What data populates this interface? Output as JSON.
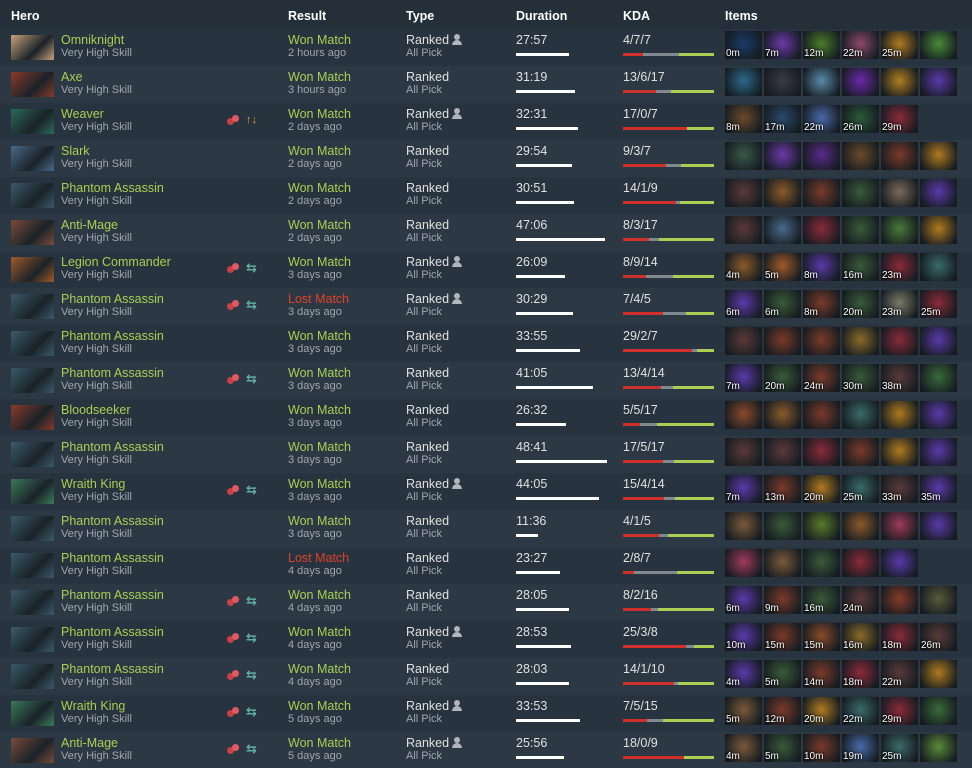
{
  "header": {
    "hero": "Hero",
    "result": "Result",
    "type": "Type",
    "duration": "Duration",
    "kda": "KDA",
    "items": "Items"
  },
  "colors": {
    "won": "#a9cf54",
    "lost": "#e0402a",
    "kills": "#d0302a",
    "deaths": "#808890",
    "assists": "#a9cf54"
  },
  "matches": [
    {
      "hero": "Omniknight",
      "hero_color": "#c9a37a",
      "skill": "Very High Skill",
      "party": false,
      "lane": "",
      "result": "Won Match",
      "won": true,
      "ago": "2 hours ago",
      "type": "Ranked",
      "solo": true,
      "mode": "All Pick",
      "duration": "27:57",
      "dur_frac": 0.58,
      "kda": "4/7/7",
      "k": 4,
      "d": 7,
      "a": 7,
      "items": [
        {
          "c": "#1a3a66",
          "t": "0m"
        },
        {
          "c": "#6a3aaa",
          "t": "7m"
        },
        {
          "c": "#4a7a2a",
          "t": "12m"
        },
        {
          "c": "#8a4a6a",
          "t": "22m"
        },
        {
          "c": "#b07a20",
          "t": "25m"
        },
        {
          "c": "#4a8a3a",
          "t": ""
        }
      ]
    },
    {
      "hero": "Axe",
      "hero_color": "#8a3a2a",
      "skill": "Very High Skill",
      "party": false,
      "lane": "",
      "result": "Won Match",
      "won": true,
      "ago": "3 hours ago",
      "type": "Ranked",
      "solo": false,
      "mode": "All Pick",
      "duration": "31:19",
      "dur_frac": 0.65,
      "kda": "13/6/17",
      "k": 13,
      "d": 6,
      "a": 17,
      "items": [
        {
          "c": "#2a6a8a",
          "t": ""
        },
        {
          "c": "#3a3a4a",
          "t": ""
        },
        {
          "c": "#5a8aaa",
          "t": ""
        },
        {
          "c": "#6a2aaa",
          "t": ""
        },
        {
          "c": "#b08020",
          "t": ""
        },
        {
          "c": "#5a3aaa",
          "t": ""
        }
      ]
    },
    {
      "hero": "Weaver",
      "hero_color": "#2a6a5a",
      "skill": "Very High Skill",
      "party": true,
      "lane": "swap",
      "result": "Won Match",
      "won": true,
      "ago": "2 days ago",
      "type": "Ranked",
      "solo": true,
      "mode": "All Pick",
      "duration": "32:31",
      "dur_frac": 0.68,
      "kda": "17/0/7",
      "k": 17,
      "d": 0,
      "a": 7,
      "items": [
        {
          "c": "#6a4a2a",
          "t": "8m"
        },
        {
          "c": "#2a4a6a",
          "t": "17m"
        },
        {
          "c": "#4a6aaa",
          "t": "22m"
        },
        {
          "c": "#2a5a3a",
          "t": "26m"
        },
        {
          "c": "#8a2a3a",
          "t": "29m"
        }
      ]
    },
    {
      "hero": "Slark",
      "hero_color": "#4a6a8a",
      "skill": "Very High Skill",
      "party": false,
      "lane": "",
      "result": "Won Match",
      "won": true,
      "ago": "2 days ago",
      "type": "Ranked",
      "solo": false,
      "mode": "All Pick",
      "duration": "29:54",
      "dur_frac": 0.62,
      "kda": "9/3/7",
      "k": 9,
      "d": 3,
      "a": 7,
      "items": [
        {
          "c": "#3a5a4a",
          "t": ""
        },
        {
          "c": "#6a3aaa",
          "t": ""
        },
        {
          "c": "#5a2a8a",
          "t": ""
        },
        {
          "c": "#6a4a2a",
          "t": ""
        },
        {
          "c": "#7a3a2a",
          "t": ""
        },
        {
          "c": "#b07a20",
          "t": ""
        }
      ]
    },
    {
      "hero": "Phantom Assassin",
      "hero_color": "#3a5a6a",
      "skill": "Very High Skill",
      "party": false,
      "lane": "",
      "result": "Won Match",
      "won": true,
      "ago": "2 days ago",
      "type": "Ranked",
      "solo": false,
      "mode": "All Pick",
      "duration": "30:51",
      "dur_frac": 0.64,
      "kda": "14/1/9",
      "k": 14,
      "d": 1,
      "a": 9,
      "items": [
        {
          "c": "#5a3a3a",
          "t": ""
        },
        {
          "c": "#8a5a2a",
          "t": ""
        },
        {
          "c": "#7a3a2a",
          "t": ""
        },
        {
          "c": "#3a5a3a",
          "t": ""
        },
        {
          "c": "#7a6a5a",
          "t": ""
        },
        {
          "c": "#5a3aaa",
          "t": ""
        }
      ]
    },
    {
      "hero": "Anti-Mage",
      "hero_color": "#7a4a3a",
      "skill": "Very High Skill",
      "party": false,
      "lane": "",
      "result": "Won Match",
      "won": true,
      "ago": "2 days ago",
      "type": "Ranked",
      "solo": false,
      "mode": "All Pick",
      "duration": "47:06",
      "dur_frac": 0.98,
      "kda": "8/3/17",
      "k": 8,
      "d": 3,
      "a": 17,
      "items": [
        {
          "c": "#5a3a3a",
          "t": ""
        },
        {
          "c": "#4a6a8a",
          "t": ""
        },
        {
          "c": "#8a2a3a",
          "t": ""
        },
        {
          "c": "#3a5a3a",
          "t": ""
        },
        {
          "c": "#4a7a3a",
          "t": ""
        },
        {
          "c": "#b07a20",
          "t": ""
        }
      ]
    },
    {
      "hero": "Legion Commander",
      "hero_color": "#a05a2a",
      "skill": "Very High Skill",
      "party": true,
      "lane": "cycle",
      "result": "Won Match",
      "won": true,
      "ago": "3 days ago",
      "type": "Ranked",
      "solo": true,
      "mode": "All Pick",
      "duration": "26:09",
      "dur_frac": 0.54,
      "kda": "8/9/14",
      "k": 8,
      "d": 9,
      "a": 14,
      "items": [
        {
          "c": "#8a5a2a",
          "t": "4m"
        },
        {
          "c": "#a05a2a",
          "t": "5m"
        },
        {
          "c": "#5a3aaa",
          "t": "8m"
        },
        {
          "c": "#3a5a3a",
          "t": "16m"
        },
        {
          "c": "#8a2a3a",
          "t": "23m"
        },
        {
          "c": "#3a6a6a",
          "t": ""
        }
      ]
    },
    {
      "hero": "Phantom Assassin",
      "hero_color": "#3a5a6a",
      "skill": "Very High Skill",
      "party": true,
      "lane": "cycle",
      "result": "Lost Match",
      "won": false,
      "ago": "3 days ago",
      "type": "Ranked",
      "solo": true,
      "mode": "All Pick",
      "duration": "30:29",
      "dur_frac": 0.63,
      "kda": "7/4/5",
      "k": 7,
      "d": 4,
      "a": 5,
      "items": [
        {
          "c": "#5a3aaa",
          "t": "6m"
        },
        {
          "c": "#3a5a3a",
          "t": "6m"
        },
        {
          "c": "#7a3a2a",
          "t": "8m"
        },
        {
          "c": "#3a5a3a",
          "t": "20m"
        },
        {
          "c": "#7a7a6a",
          "t": "23m"
        },
        {
          "c": "#8a2a3a",
          "t": "25m"
        }
      ]
    },
    {
      "hero": "Phantom Assassin",
      "hero_color": "#3a5a6a",
      "skill": "Very High Skill",
      "party": false,
      "lane": "",
      "result": "Won Match",
      "won": true,
      "ago": "3 days ago",
      "type": "Ranked",
      "solo": false,
      "mode": "All Pick",
      "duration": "33:55",
      "dur_frac": 0.7,
      "kda": "29/2/7",
      "k": 29,
      "d": 2,
      "a": 7,
      "items": [
        {
          "c": "#5a3a3a",
          "t": ""
        },
        {
          "c": "#7a3a2a",
          "t": ""
        },
        {
          "c": "#7a3a2a",
          "t": ""
        },
        {
          "c": "#8a6a2a",
          "t": ""
        },
        {
          "c": "#8a2a3a",
          "t": ""
        },
        {
          "c": "#5a3aaa",
          "t": ""
        }
      ]
    },
    {
      "hero": "Phantom Assassin",
      "hero_color": "#3a5a6a",
      "skill": "Very High Skill",
      "party": true,
      "lane": "cycle",
      "result": "Won Match",
      "won": true,
      "ago": "3 days ago",
      "type": "Ranked",
      "solo": false,
      "mode": "All Pick",
      "duration": "41:05",
      "dur_frac": 0.85,
      "kda": "13/4/14",
      "k": 13,
      "d": 4,
      "a": 14,
      "items": [
        {
          "c": "#5a3aaa",
          "t": "7m"
        },
        {
          "c": "#3a5a3a",
          "t": "20m"
        },
        {
          "c": "#7a3a2a",
          "t": "24m"
        },
        {
          "c": "#3a5a3a",
          "t": "30m"
        },
        {
          "c": "#5a3a3a",
          "t": "38m"
        },
        {
          "c": "#3a6a3a",
          "t": ""
        }
      ]
    },
    {
      "hero": "Bloodseeker",
      "hero_color": "#8a3a2a",
      "skill": "Very High Skill",
      "party": false,
      "lane": "",
      "result": "Won Match",
      "won": true,
      "ago": "3 days ago",
      "type": "Ranked",
      "solo": false,
      "mode": "All Pick",
      "duration": "26:32",
      "dur_frac": 0.55,
      "kda": "5/5/17",
      "k": 5,
      "d": 5,
      "a": 17,
      "items": [
        {
          "c": "#8a4a2a",
          "t": ""
        },
        {
          "c": "#8a5a2a",
          "t": ""
        },
        {
          "c": "#7a3a2a",
          "t": ""
        },
        {
          "c": "#3a6a6a",
          "t": ""
        },
        {
          "c": "#b07a20",
          "t": ""
        },
        {
          "c": "#5a3aaa",
          "t": ""
        }
      ]
    },
    {
      "hero": "Phantom Assassin",
      "hero_color": "#3a5a6a",
      "skill": "Very High Skill",
      "party": false,
      "lane": "",
      "result": "Won Match",
      "won": true,
      "ago": "3 days ago",
      "type": "Ranked",
      "solo": false,
      "mode": "All Pick",
      "duration": "48:41",
      "dur_frac": 1.0,
      "kda": "17/5/17",
      "k": 17,
      "d": 5,
      "a": 17,
      "items": [
        {
          "c": "#5a3a3a",
          "t": ""
        },
        {
          "c": "#5a3a3a",
          "t": ""
        },
        {
          "c": "#8a2a3a",
          "t": ""
        },
        {
          "c": "#7a3a2a",
          "t": ""
        },
        {
          "c": "#b07a20",
          "t": ""
        },
        {
          "c": "#5a3aaa",
          "t": ""
        }
      ]
    },
    {
      "hero": "Wraith King",
      "hero_color": "#3a7a5a",
      "skill": "Very High Skill",
      "party": true,
      "lane": "cycle",
      "result": "Won Match",
      "won": true,
      "ago": "3 days ago",
      "type": "Ranked",
      "solo": true,
      "mode": "All Pick",
      "duration": "44:05",
      "dur_frac": 0.91,
      "kda": "15/4/14",
      "k": 15,
      "d": 4,
      "a": 14,
      "items": [
        {
          "c": "#5a3aaa",
          "t": "7m"
        },
        {
          "c": "#7a3a2a",
          "t": "13m"
        },
        {
          "c": "#b07a20",
          "t": "20m"
        },
        {
          "c": "#3a6a6a",
          "t": "25m"
        },
        {
          "c": "#5a3a3a",
          "t": "33m"
        },
        {
          "c": "#5a3aaa",
          "t": "35m"
        }
      ]
    },
    {
      "hero": "Phantom Assassin",
      "hero_color": "#3a5a6a",
      "skill": "Very High Skill",
      "party": false,
      "lane": "",
      "result": "Won Match",
      "won": true,
      "ago": "3 days ago",
      "type": "Ranked",
      "solo": false,
      "mode": "All Pick",
      "duration": "11:36",
      "dur_frac": 0.24,
      "kda": "4/1/5",
      "k": 4,
      "d": 1,
      "a": 5,
      "items": [
        {
          "c": "#7a5a3a",
          "t": ""
        },
        {
          "c": "#3a5a3a",
          "t": ""
        },
        {
          "c": "#5a7a2a",
          "t": ""
        },
        {
          "c": "#8a5a2a",
          "t": ""
        },
        {
          "c": "#a03a5a",
          "t": ""
        },
        {
          "c": "#5a3aaa",
          "t": ""
        }
      ]
    },
    {
      "hero": "Phantom Assassin",
      "hero_color": "#3a5a6a",
      "skill": "Very High Skill",
      "party": false,
      "lane": "",
      "result": "Lost Match",
      "won": false,
      "ago": "4 days ago",
      "type": "Ranked",
      "solo": false,
      "mode": "All Pick",
      "duration": "23:27",
      "dur_frac": 0.48,
      "kda": "2/8/7",
      "k": 2,
      "d": 8,
      "a": 7,
      "items": [
        {
          "c": "#a03a5a",
          "t": ""
        },
        {
          "c": "#7a5a3a",
          "t": ""
        },
        {
          "c": "#3a5a3a",
          "t": ""
        },
        {
          "c": "#8a2a3a",
          "t": ""
        },
        {
          "c": "#5a3aaa",
          "t": ""
        }
      ]
    },
    {
      "hero": "Phantom Assassin",
      "hero_color": "#3a5a6a",
      "skill": "Very High Skill",
      "party": true,
      "lane": "cycle",
      "result": "Won Match",
      "won": true,
      "ago": "4 days ago",
      "type": "Ranked",
      "solo": false,
      "mode": "All Pick",
      "duration": "28:05",
      "dur_frac": 0.58,
      "kda": "8/2/16",
      "k": 8,
      "d": 2,
      "a": 16,
      "items": [
        {
          "c": "#5a3aaa",
          "t": "6m"
        },
        {
          "c": "#7a3a2a",
          "t": "9m"
        },
        {
          "c": "#3a5a3a",
          "t": "16m"
        },
        {
          "c": "#5a3a3a",
          "t": "24m"
        },
        {
          "c": "#8a3a2a",
          "t": ""
        },
        {
          "c": "#5a5a3a",
          "t": ""
        }
      ]
    },
    {
      "hero": "Phantom Assassin",
      "hero_color": "#3a5a6a",
      "skill": "Very High Skill",
      "party": true,
      "lane": "cycle",
      "result": "Won Match",
      "won": true,
      "ago": "4 days ago",
      "type": "Ranked",
      "solo": true,
      "mode": "All Pick",
      "duration": "28:53",
      "dur_frac": 0.6,
      "kda": "25/3/8",
      "k": 25,
      "d": 3,
      "a": 8,
      "items": [
        {
          "c": "#5a3aaa",
          "t": "10m"
        },
        {
          "c": "#7a3a2a",
          "t": "15m"
        },
        {
          "c": "#8a4a2a",
          "t": "15m"
        },
        {
          "c": "#8a6a2a",
          "t": "16m"
        },
        {
          "c": "#8a2a3a",
          "t": "18m"
        },
        {
          "c": "#5a3a3a",
          "t": "26m"
        }
      ]
    },
    {
      "hero": "Phantom Assassin",
      "hero_color": "#3a5a6a",
      "skill": "Very High Skill",
      "party": true,
      "lane": "cycle",
      "result": "Won Match",
      "won": true,
      "ago": "4 days ago",
      "type": "Ranked",
      "solo": false,
      "mode": "All Pick",
      "duration": "28:03",
      "dur_frac": 0.58,
      "kda": "14/1/10",
      "k": 14,
      "d": 1,
      "a": 10,
      "items": [
        {
          "c": "#5a3aaa",
          "t": "4m"
        },
        {
          "c": "#3a5a3a",
          "t": "5m"
        },
        {
          "c": "#7a3a2a",
          "t": "14m"
        },
        {
          "c": "#8a2a3a",
          "t": "18m"
        },
        {
          "c": "#5a3a3a",
          "t": "22m"
        },
        {
          "c": "#b07a20",
          "t": ""
        }
      ]
    },
    {
      "hero": "Wraith King",
      "hero_color": "#3a7a5a",
      "skill": "Very High Skill",
      "party": true,
      "lane": "cycle",
      "result": "Won Match",
      "won": true,
      "ago": "5 days ago",
      "type": "Ranked",
      "solo": true,
      "mode": "All Pick",
      "duration": "33:53",
      "dur_frac": 0.7,
      "kda": "7/5/15",
      "k": 7,
      "d": 5,
      "a": 15,
      "items": [
        {
          "c": "#7a5a3a",
          "t": "5m"
        },
        {
          "c": "#7a3a2a",
          "t": "12m"
        },
        {
          "c": "#b07a20",
          "t": "20m"
        },
        {
          "c": "#3a6a6a",
          "t": "22m"
        },
        {
          "c": "#8a2a3a",
          "t": "29m"
        },
        {
          "c": "#3a6a3a",
          "t": ""
        }
      ]
    },
    {
      "hero": "Anti-Mage",
      "hero_color": "#7a4a3a",
      "skill": "Very High Skill",
      "party": true,
      "lane": "cycle",
      "result": "Won Match",
      "won": true,
      "ago": "5 days ago",
      "type": "Ranked",
      "solo": true,
      "mode": "All Pick",
      "duration": "25:56",
      "dur_frac": 0.53,
      "kda": "18/0/9",
      "k": 18,
      "d": 0,
      "a": 9,
      "items": [
        {
          "c": "#7a5a3a",
          "t": "4m"
        },
        {
          "c": "#3a5a3a",
          "t": "5m"
        },
        {
          "c": "#7a3a2a",
          "t": "10m"
        },
        {
          "c": "#4a6aaa",
          "t": "19m"
        },
        {
          "c": "#3a6a6a",
          "t": "25m"
        },
        {
          "c": "#5a8a3a",
          "t": ""
        }
      ]
    }
  ]
}
